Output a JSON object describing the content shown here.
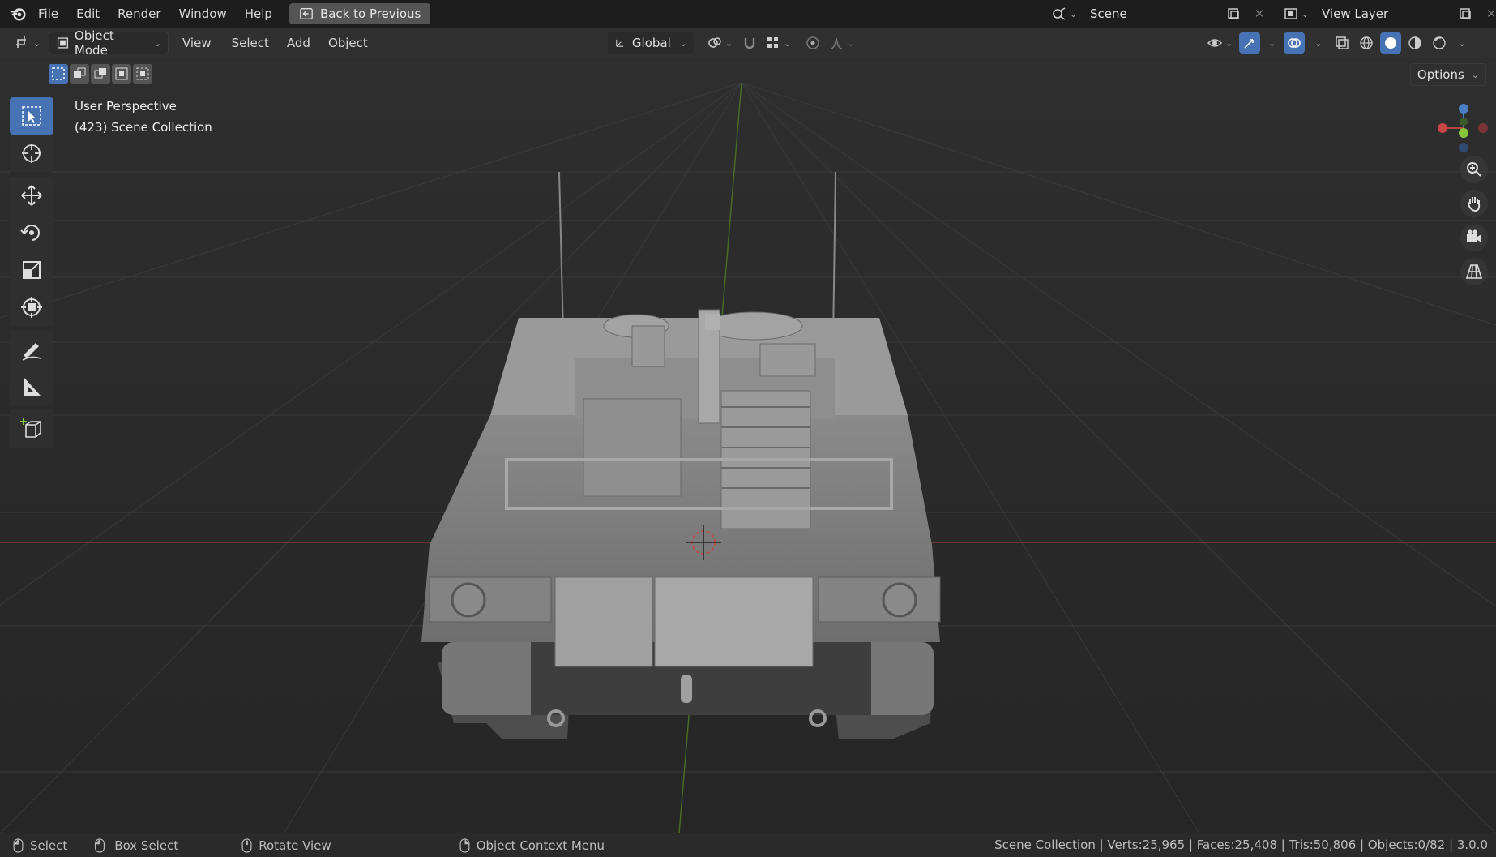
{
  "menu": {
    "file": "File",
    "edit": "Edit",
    "render": "Render",
    "window": "Window",
    "help": "Help",
    "back": "Back to Previous"
  },
  "scene": {
    "name": "Scene",
    "view_layer": "View Layer"
  },
  "header": {
    "mode": "Object Mode",
    "view": "View",
    "select": "Select",
    "add": "Add",
    "object": "Object",
    "transform_orientation": "Global",
    "options": "Options"
  },
  "viewport": {
    "perspective": "User Perspective",
    "collection": "(423) Scene Collection"
  },
  "status": {
    "select": "Select",
    "box_select": "Box Select",
    "rotate_view": "Rotate View",
    "context_menu": "Object Context Menu",
    "stats": "Scene Collection | Verts:25,965 | Faces:25,408 | Tris:50,806 | Objects:0/82 | 3.0.0"
  },
  "colors": {
    "x_axis": "#b34545",
    "y_axis": "#6a9a2f",
    "z_axis": "#4a7fc1",
    "active_tool": "#4772b3"
  },
  "icons": [
    "blender-logo-icon",
    "select-cursor-icon",
    "cursor-icon",
    "move-icon",
    "rotate-icon",
    "scale-icon",
    "transform-icon",
    "annotate-icon",
    "measure-icon",
    "add-cube-icon",
    "zoom-icon",
    "hand-icon",
    "camera-icon",
    "grid-icon"
  ]
}
